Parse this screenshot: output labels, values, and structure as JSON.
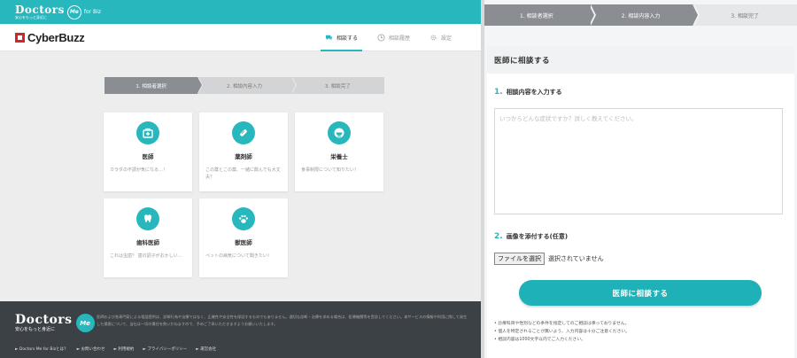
{
  "left": {
    "brand": {
      "name": "Doctors",
      "badge": "Me",
      "sub": "安心をもっと身近に",
      "suffix": "for Biz"
    },
    "company": "CyberBuzz",
    "nav": [
      {
        "label": "相談する",
        "icon": "chat-icon"
      },
      {
        "label": "相談履歴",
        "icon": "clock-icon"
      },
      {
        "label": "設定",
        "icon": "gear-icon"
      }
    ],
    "steps": [
      "1. 相談者選択",
      "2. 相談内容入力",
      "3. 相談完了"
    ],
    "cards": [
      {
        "title": "医師",
        "desc": "カラダの不調が気になる…！",
        "icon": "medical-kit-icon"
      },
      {
        "title": "薬剤師",
        "desc": "この薬とこの薬、一緒に飲んでも大丈夫？",
        "icon": "pill-icon"
      },
      {
        "title": "栄養士",
        "desc": "食事制限について知りたい！",
        "icon": "bowl-icon"
      },
      {
        "title": "歯科医師",
        "desc": "これは虫歯？ 歯の調子がおかしい…",
        "icon": "tooth-icon"
      },
      {
        "title": "獣医師",
        "desc": "ペットの病気について聞きたい！",
        "icon": "paw-icon"
      }
    ],
    "footer": {
      "brand": "Doctors",
      "badge": "Me",
      "sub": "安心をもっと身近に",
      "text": "医師および各専門家による相談提供は、診断行為や治療ではなく、正確性や安全性を保証するものでもありません。適切な診断・治療を求める場合は、医療機関等を受診してください。本サービスの情報や利用に際して発生した損害について、当社は一切の責任を負いかねますので、予めご了承いただきますようお願いいたします。",
      "links": [
        "► Doctors Me for Bizとは？",
        "► お問い合わせ",
        "► 利用規約",
        "► プライバシーポリシー",
        "► 運営会社"
      ]
    }
  },
  "right": {
    "steps": [
      "1. 相談者選択",
      "2. 相談内容入力",
      "3. 相談完了"
    ],
    "heading": "医師に相談する",
    "section1": {
      "num": "1.",
      "label": "相談内容を入力する"
    },
    "textarea_placeholder": "いつからどんな症状ですか？詳しく教えてください。",
    "section2": {
      "num": "2.",
      "label": "画像を添付する(任意)"
    },
    "file_button": "ファイルを選択",
    "file_status": "選択されていません",
    "submit": "医師に相談する",
    "notes": [
      "診療科目や性別などの条件を指定してのご相談は承っておりません。",
      "個人を特定されることが無いよう、入力内容は十分ご注意ください。",
      "相談内容は1000文字以内でご入力ください。"
    ]
  },
  "colors": {
    "accent": "#27b7bd",
    "brand_red": "#d8232a",
    "step_active": "#8a8d92"
  }
}
